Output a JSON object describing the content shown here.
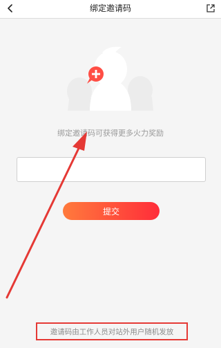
{
  "header": {
    "title": "绑定邀请码",
    "back_icon": "chevron-left-icon",
    "share_icon": "share-icon"
  },
  "main": {
    "illustration_icon": "user-group-add-icon",
    "hint": "绑定邀请码可获得更多火力奖励",
    "input_value": "",
    "submit_label": "提交"
  },
  "footer": {
    "notice": "邀请码由工作人员对站外用户随机发放"
  },
  "colors": {
    "accent_start": "#ff7a3c",
    "accent_end": "#ff2d3a",
    "annotation_red": "#e53935",
    "background": "#f5f5f5"
  }
}
